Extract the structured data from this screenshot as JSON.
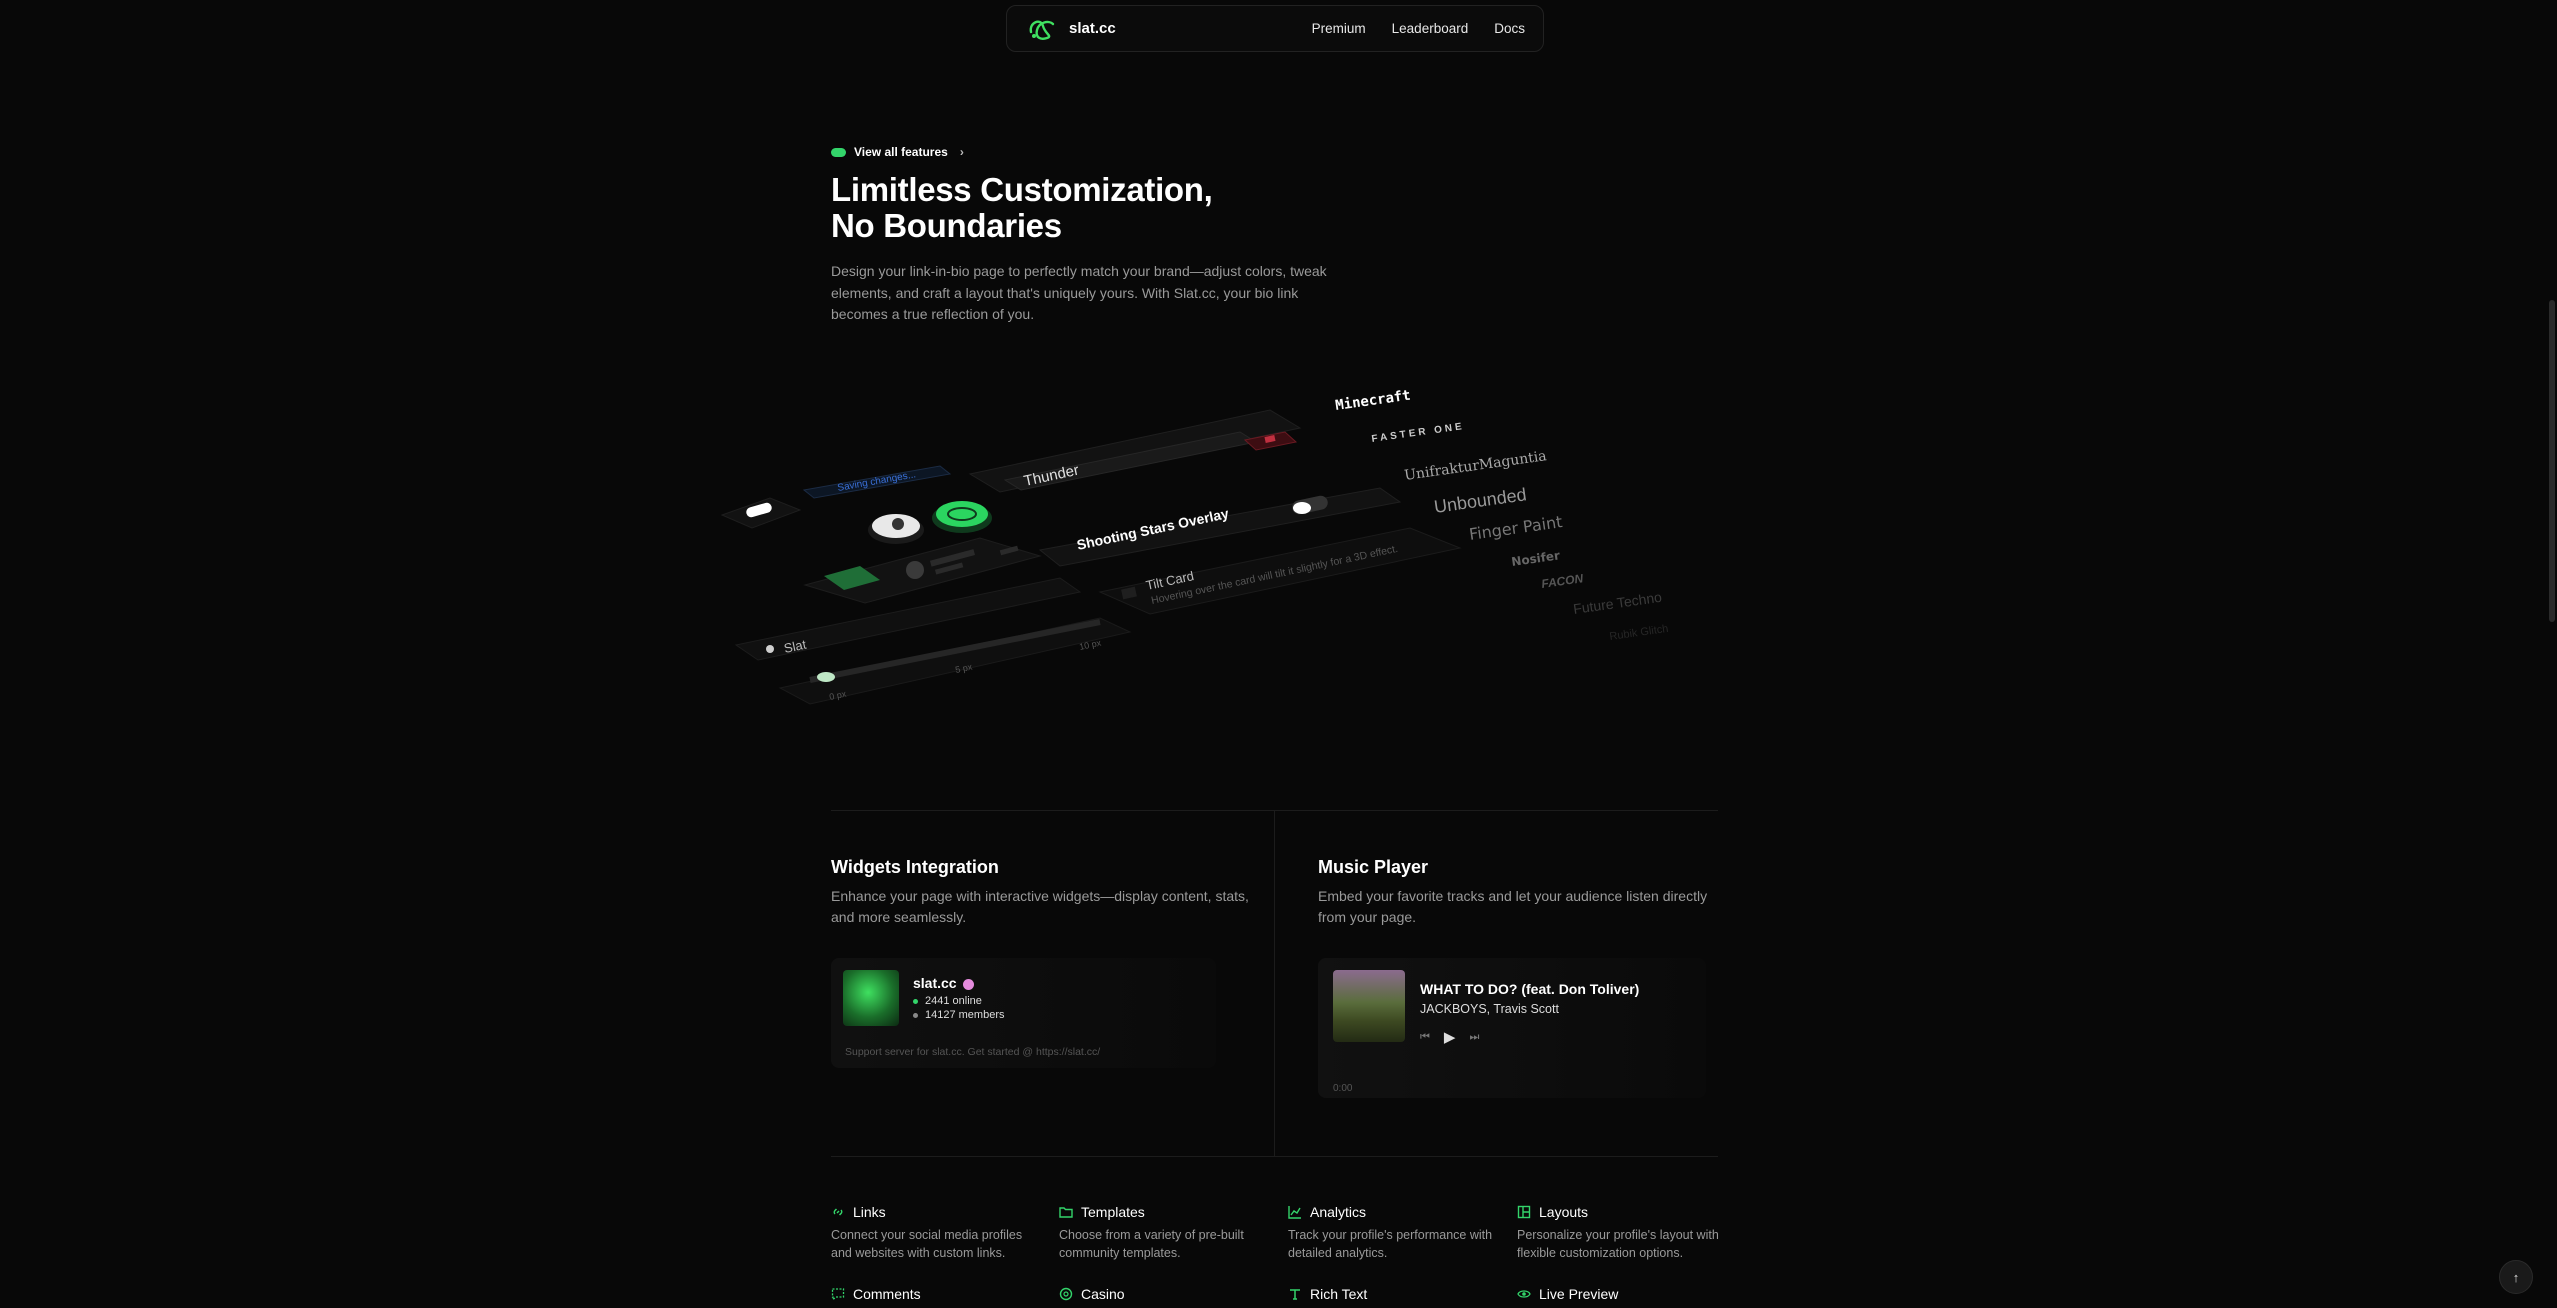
{
  "nav": {
    "brand": "slat.cc",
    "links": [
      "Premium",
      "Leaderboard",
      "Docs"
    ]
  },
  "hero": {
    "pill_label": "View all features",
    "headline_line1": "Limitless Customization,",
    "headline_line2": "No Boundaries",
    "description": "Design your link-in-bio page to perfectly match your brand—adjust colors, tweak elements, and craft a layout that's uniquely yours. With Slat.cc, your bio link becomes a true reflection of you."
  },
  "showcase": {
    "saving_label": "Saving changes...",
    "font_input_value": "Thunder",
    "overlay_label": "Shooting Stars Overlay",
    "tilt_title": "Tilt Card",
    "tilt_desc": "Hovering over the card will tilt it slightly for a 3D effect.",
    "username_value": "Slat",
    "slider_labels": [
      "0 px",
      "5 px",
      "10 px"
    ],
    "font_names": [
      "Minecraft",
      "FASTER ONE",
      "UnifrakturMaguntia",
      "Unbounded",
      "Finger Paint",
      "Nosifer",
      "FACON",
      "Future Techno",
      "Rubik Glitch"
    ]
  },
  "widgets": {
    "title": "Widgets Integration",
    "description": "Enhance your page with interactive widgets—display content, stats, and more seamlessly.",
    "server_name": "slat.cc",
    "online": "2441 online",
    "members": "14127 members",
    "footer": "Support server for slat.cc. Get started @ https://slat.cc/"
  },
  "music": {
    "title": "Music Player",
    "description": "Embed your favorite tracks and let your audience listen directly from your page.",
    "track": "WHAT TO DO? (feat. Don Toliver)",
    "artist": "JACKBOYS, Travis Scott",
    "time": "0:00"
  },
  "features": [
    {
      "icon": "link-icon",
      "title": "Links",
      "desc": "Connect your social media profiles and websites with custom links."
    },
    {
      "icon": "folder-icon",
      "title": "Templates",
      "desc": "Choose from a variety of pre-built community templates."
    },
    {
      "icon": "chart-icon",
      "title": "Analytics",
      "desc": "Track your profile's performance with detailed analytics."
    },
    {
      "icon": "layout-icon",
      "title": "Layouts",
      "desc": "Personalize your profile's layout with flexible customization options."
    },
    {
      "icon": "comment-icon",
      "title": "Comments",
      "desc": ""
    },
    {
      "icon": "casino-icon",
      "title": "Casino",
      "desc": ""
    },
    {
      "icon": "text-icon",
      "title": "Rich Text",
      "desc": ""
    },
    {
      "icon": "eye-icon",
      "title": "Live Preview",
      "desc": ""
    }
  ],
  "colors": {
    "accent": "#33d46a",
    "background": "#080808",
    "muted_text": "#9a9a9a"
  }
}
